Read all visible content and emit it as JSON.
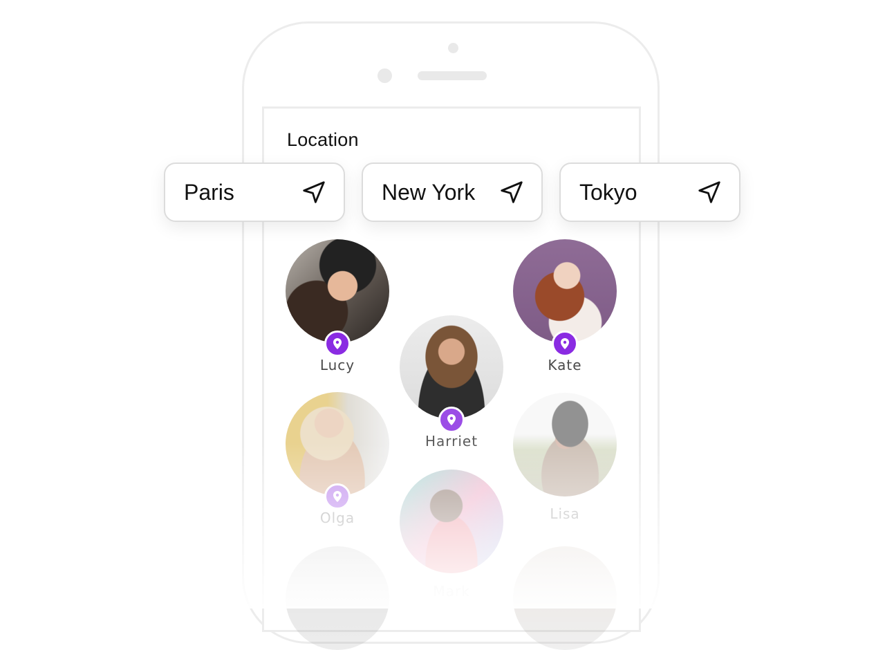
{
  "screen": {
    "section_title": "Location"
  },
  "locations": [
    {
      "city": "Paris",
      "icon": "navigation-arrow-icon"
    },
    {
      "city": "New York",
      "icon": "navigation-arrow-icon"
    },
    {
      "city": "Tokyo",
      "icon": "navigation-arrow-icon"
    }
  ],
  "people": [
    {
      "name": "Lucy",
      "has_location_badge": true
    },
    {
      "name": "Kate",
      "has_location_badge": true
    },
    {
      "name": "Harriet",
      "has_location_badge": true
    },
    {
      "name": "Olga",
      "has_location_badge": true
    },
    {
      "name": "Lisa",
      "has_location_badge": false
    },
    {
      "name": "Mark",
      "has_location_badge": false
    }
  ],
  "colors": {
    "accent": "#8a2be2",
    "frame": "#ececec",
    "text": "#111111",
    "name_text": "#4a4a4a"
  }
}
